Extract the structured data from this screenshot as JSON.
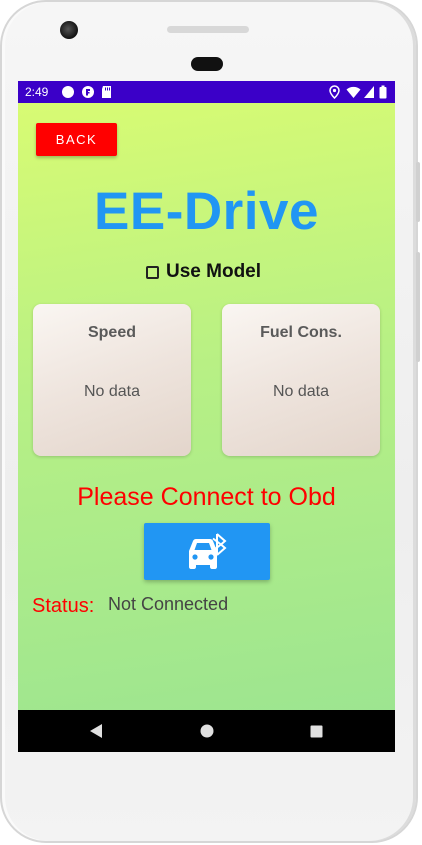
{
  "statusbar": {
    "time": "2:49",
    "icons": [
      "circle-icon",
      "app-notification-icon",
      "sd-card-icon",
      "location-icon",
      "wifi-icon",
      "signal-icon",
      "battery-icon"
    ]
  },
  "app": {
    "back_label": "BACK",
    "title": "EE-Drive",
    "use_model_label": "Use Model",
    "use_model_checked": false,
    "cards": [
      {
        "title": "Speed",
        "value": "No data"
      },
      {
        "title": "Fuel Cons.",
        "value": "No data"
      }
    ],
    "connect_message": "Please Connect to Obd",
    "connect_button_icon": "car-bluetooth-icon",
    "status_label": "Status:",
    "status_value": "Not Connected"
  },
  "navbar": {
    "icons": [
      "back-triangle-icon",
      "home-circle-icon",
      "recents-square-icon"
    ]
  },
  "colors": {
    "status_bar": "#3b00c8",
    "back_button": "#ff0000",
    "title": "#2196f3",
    "connect_message": "#ff0000",
    "obd_button": "#2196f3",
    "status_label": "#ff0000",
    "background_top": "#d8fb73",
    "background_bottom": "#9de590"
  }
}
